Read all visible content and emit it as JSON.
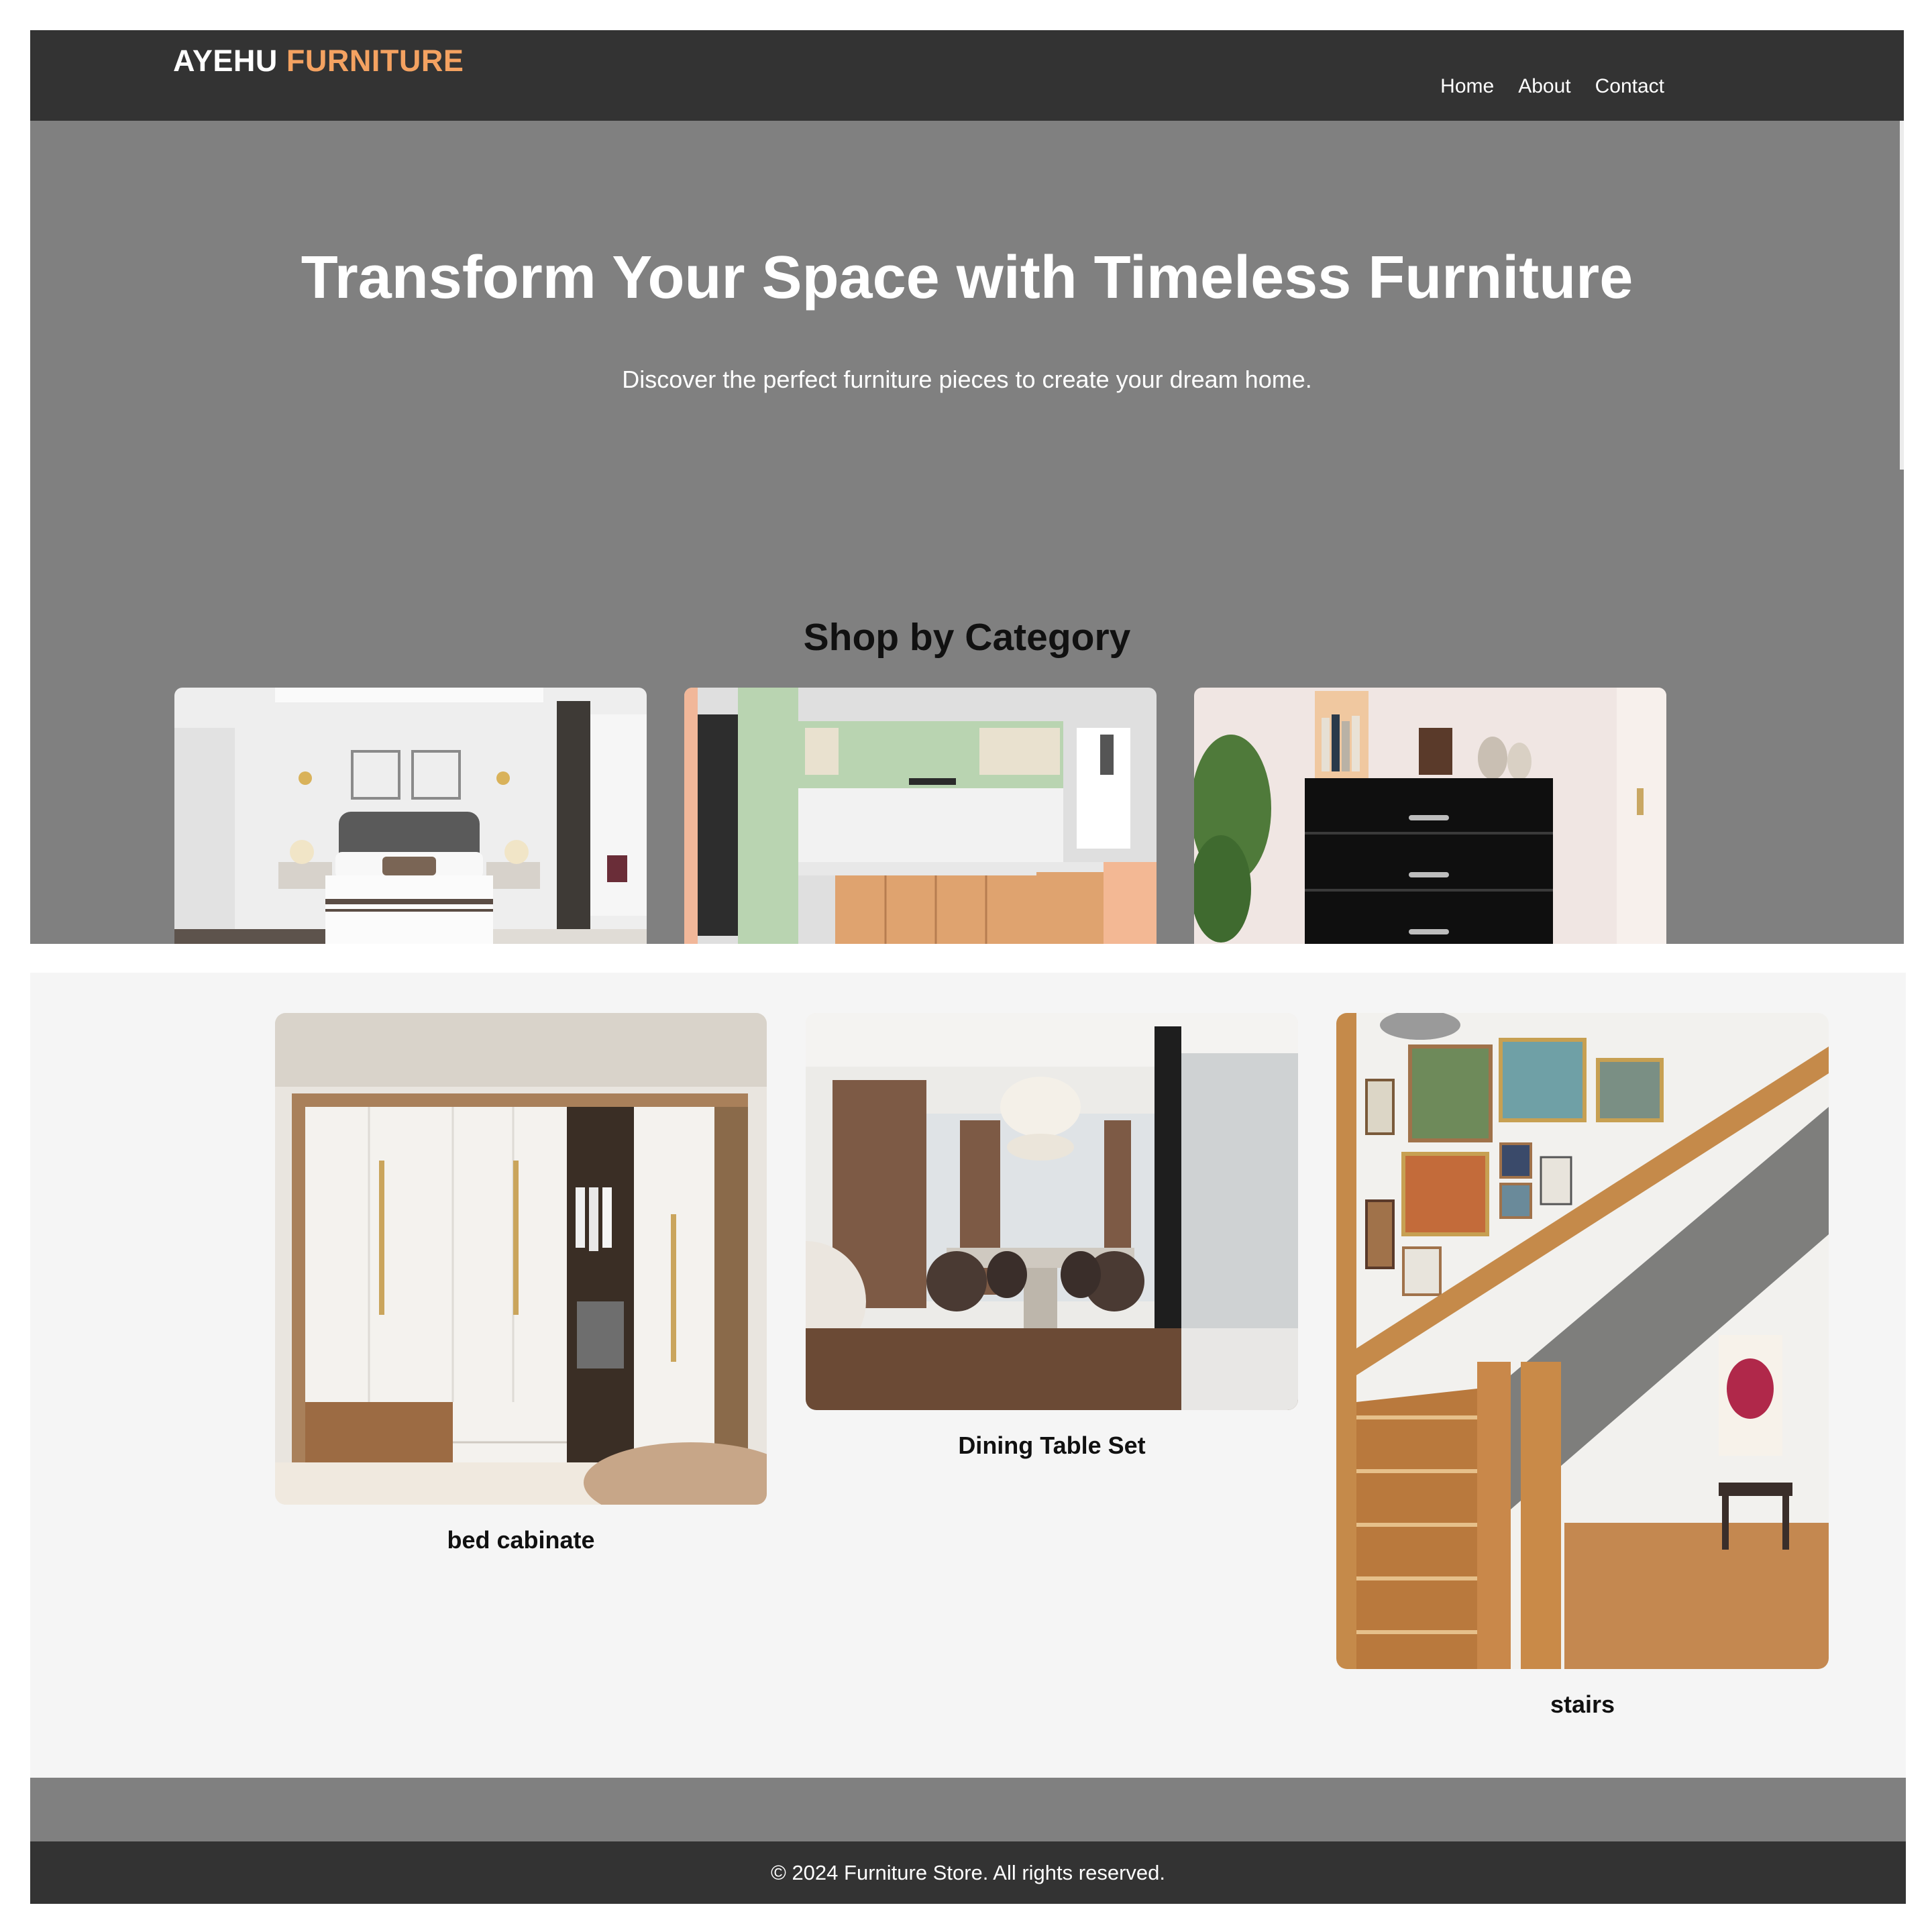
{
  "site": {
    "logo_primary": "AYEHU",
    "logo_accent": "FURNITURE",
    "nav": [
      {
        "label": "Home"
      },
      {
        "label": "About"
      },
      {
        "label": "Contact"
      }
    ]
  },
  "hero": {
    "title": "Transform Your Space with Timeless Furniture",
    "subtitle": "Discover the perfect furniture pieces to create your dream home."
  },
  "categories": {
    "heading": "Shop by Category",
    "items": [
      {
        "image": "bedroom-photo"
      },
      {
        "image": "kitchen-photo"
      },
      {
        "image": "dresser-photo"
      }
    ]
  },
  "products": [
    {
      "caption": "bed cabinate",
      "image": "wardrobe-photo"
    },
    {
      "caption": "Dining Table Set",
      "image": "dining-room-photo"
    },
    {
      "caption": "stairs",
      "image": "staircase-photo"
    }
  ],
  "footer": {
    "text": "© 2024 Furniture Store. All rights reserved."
  },
  "colors": {
    "nav_bg": "#333333",
    "hero_bg": "#808080",
    "logo_accent": "#f4a261",
    "page_bg": "#f5f5f5",
    "footer_bg": "#333333"
  }
}
